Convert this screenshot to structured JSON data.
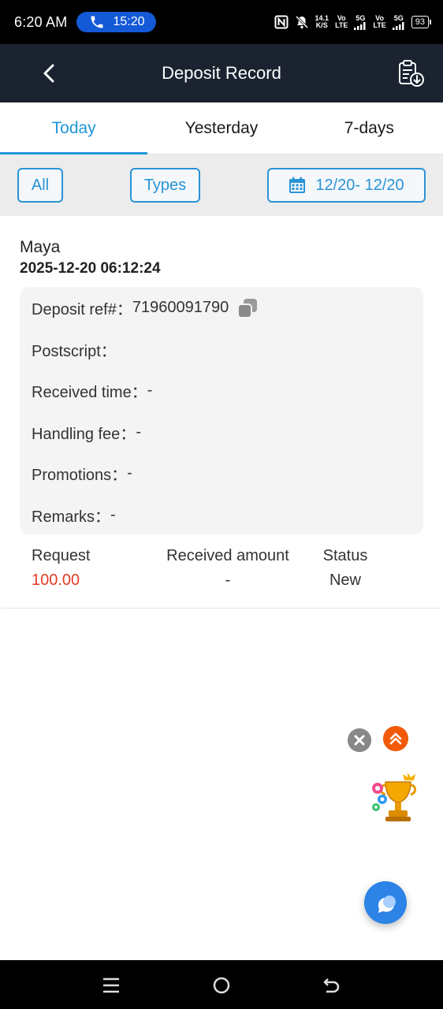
{
  "status_bar": {
    "time": "6:20 AM",
    "call_timer": "15:20",
    "net_speed_top": "14.1",
    "net_speed_bottom": "K/S",
    "sim1_top": "Vo",
    "sim1_bottom": "LTE",
    "sim1_gen": "5G",
    "sim2_top": "Vo",
    "sim2_bottom": "LTE",
    "sim2_gen": "5G",
    "battery": "93"
  },
  "header": {
    "title": "Deposit Record",
    "back_icon": "chevron-left-icon",
    "download_icon": "clipboard-download-icon"
  },
  "tabs": [
    {
      "label": "Today",
      "active": true
    },
    {
      "label": "Yesterday",
      "active": false
    },
    {
      "label": "7-days",
      "active": false
    }
  ],
  "filters": {
    "all_label": "All",
    "types_label": "Types",
    "date_range": "12/20- 12/20",
    "accent_color": "#2a93d6"
  },
  "record": {
    "method": "Maya",
    "datetime": "2025-12-20 06:12:24",
    "deposit_ref_label": "Deposit ref#：",
    "deposit_ref_value": "71960091790",
    "postscript_label": "Postscript：",
    "received_time_label": "Received time：",
    "received_time_value": "-",
    "handling_fee_label": "Handling fee：",
    "handling_fee_value": "-",
    "promotions_label": "Promotions：",
    "promotions_value": "-",
    "remarks_label": "Remarks：",
    "remarks_value": "-",
    "request_label": "Request",
    "request_value": "100.00",
    "received_amount_label": "Received amount",
    "received_amount_value": "-",
    "status_label": "Status",
    "status_value": "New",
    "request_color": "#e23b24"
  },
  "floating": {
    "close_icon": "close-icon",
    "scroll_top_icon": "double-chevron-up-icon",
    "trophy_icon": "trophy-icon",
    "chat_icon": "chat-bubble-icon"
  }
}
